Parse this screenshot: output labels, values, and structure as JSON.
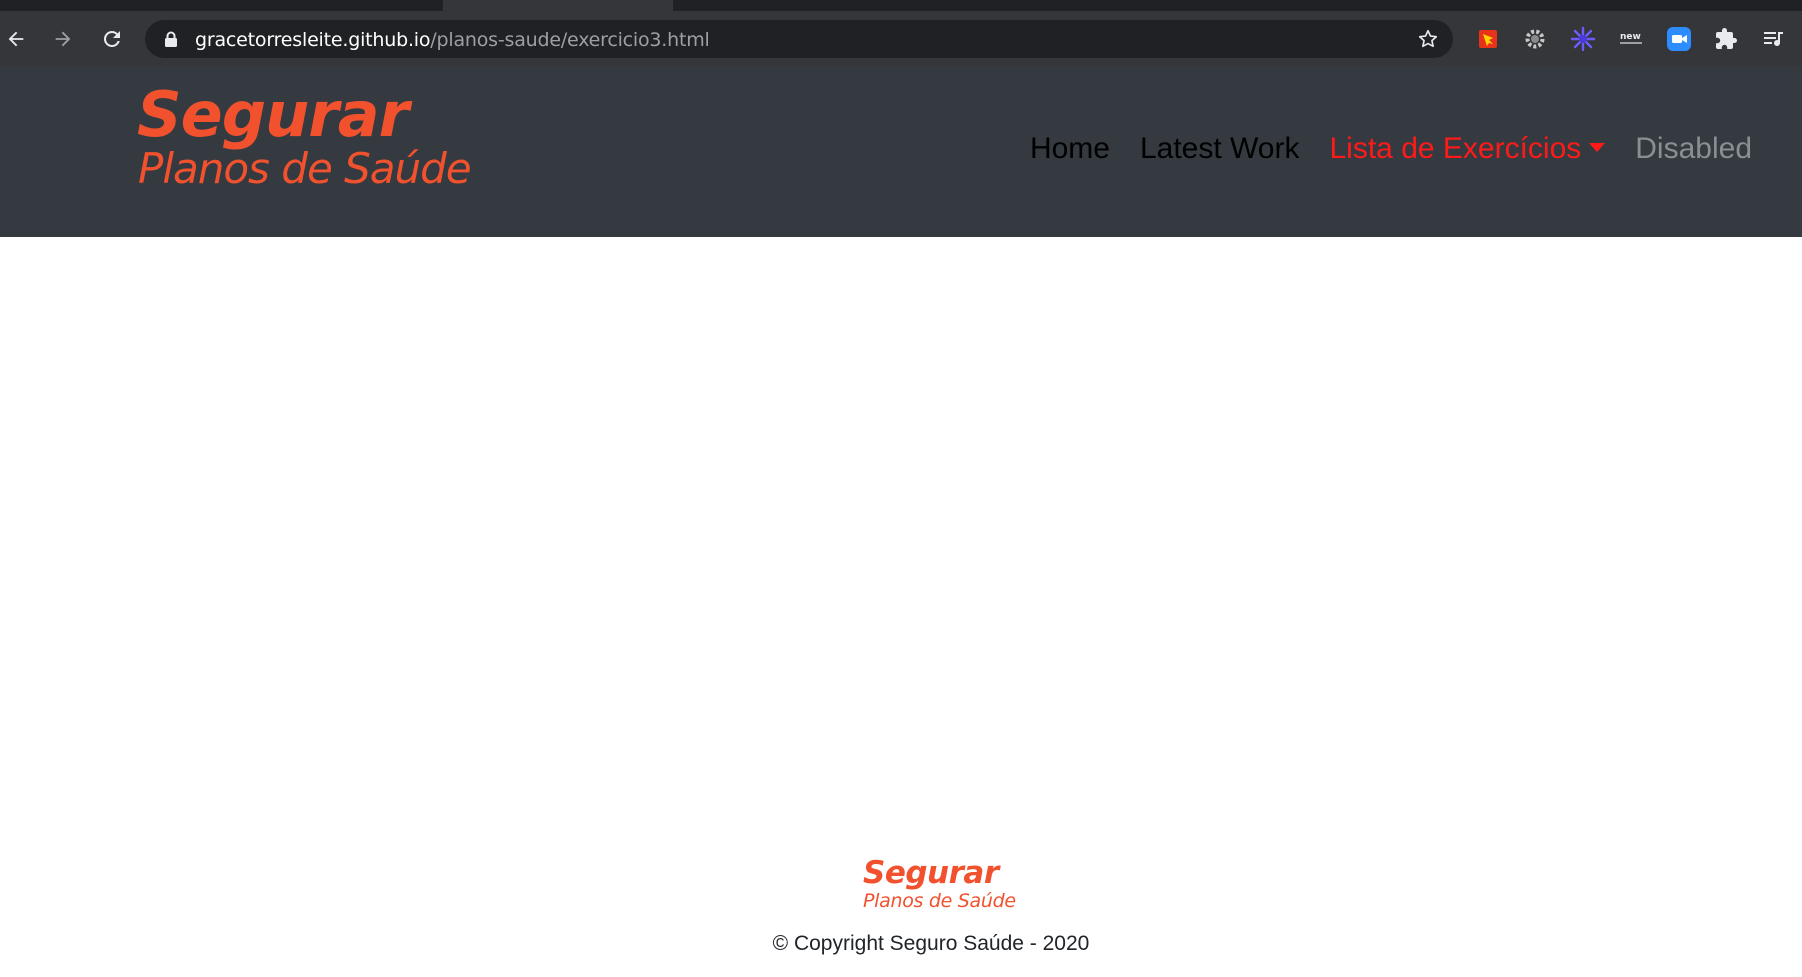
{
  "browser": {
    "url_host": "gracetorresleite.github.io",
    "url_path": "/planos-saude/exercicio3.html",
    "icons": {
      "back": "arrow-left-icon",
      "forward": "arrow-right-icon",
      "reload": "reload-icon",
      "lock": "lock-icon",
      "bookmark": "star-icon",
      "extensions": [
        "extension-red-yellow-icon",
        "gear-extension-icon",
        "snowflake-extension-icon",
        "new-extension-icon",
        "zoom-extension-icon",
        "puzzle-icon",
        "media-queue-icon"
      ]
    }
  },
  "header": {
    "logo_line1": "Segurar",
    "logo_line2": "Planos de Saúde",
    "nav": {
      "home": "Home",
      "latest_work": "Latest Work",
      "exercises": "Lista de Exercícios",
      "disabled": "Disabled"
    }
  },
  "footer": {
    "logo_line1": "Segurar",
    "logo_line2": "Planos de Saúde",
    "copyright": "© Copyright Seguro Saúde - 2020"
  },
  "colors": {
    "brand_orange": "#f2512e",
    "active_nav": "#ff1a1a",
    "header_bg": "#343a40"
  }
}
